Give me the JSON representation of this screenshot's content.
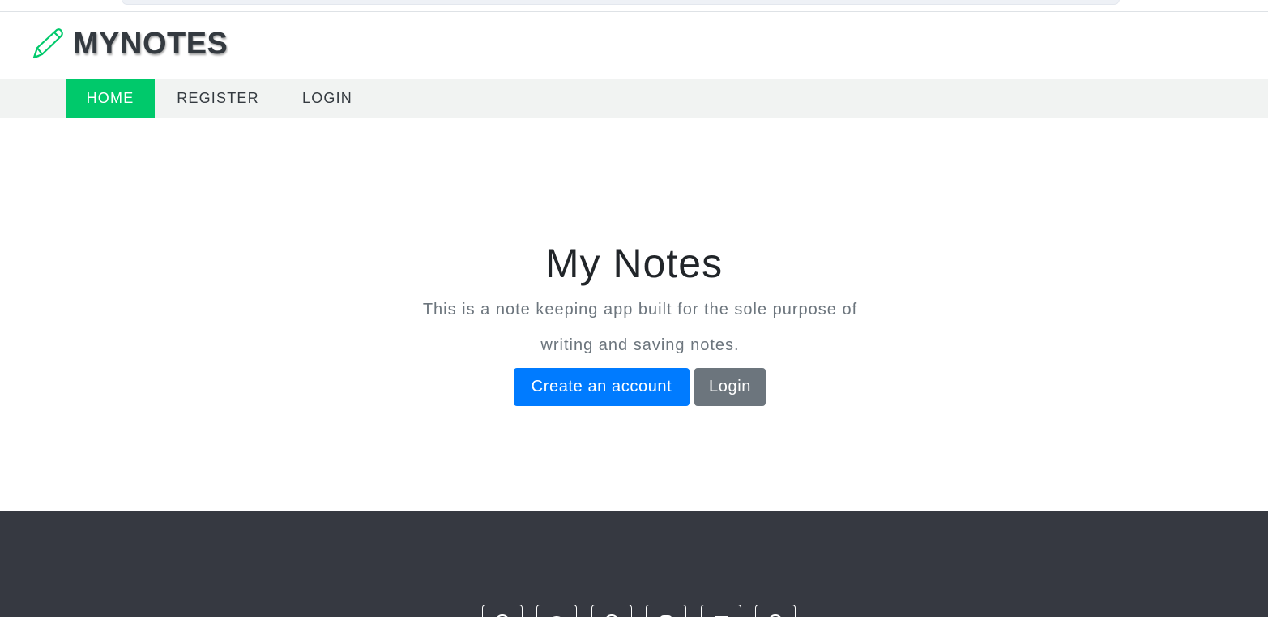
{
  "brand": {
    "title": "MYNOTES",
    "icon": "pencil-icon",
    "accent_color": "#00c96b"
  },
  "nav": {
    "items": [
      {
        "label": "HOME",
        "active": true
      },
      {
        "label": "REGISTER",
        "active": false
      },
      {
        "label": "LOGIN",
        "active": false
      }
    ]
  },
  "hero": {
    "title": "My Notes",
    "line1": "This is a note keeping app built for the sole purpose of",
    "line2": "writing and saving notes.",
    "primary_button": "Create an account",
    "secondary_button": "Login"
  },
  "footer": {
    "background": "#363941",
    "social_icons": [
      "social-icon-1",
      "social-icon-2",
      "social-icon-3",
      "social-icon-4",
      "social-icon-5",
      "social-icon-6"
    ]
  }
}
